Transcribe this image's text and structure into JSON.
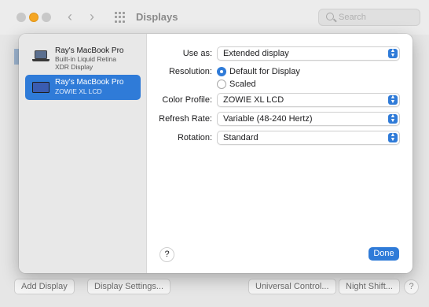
{
  "window": {
    "title": "Displays",
    "search_placeholder": "Search"
  },
  "sidebar": {
    "displays": [
      {
        "name": "Ray's MacBook Pro",
        "sub1": "Built-in Liquid Retina",
        "sub2": "XDR Display",
        "icon": "laptop-icon",
        "selected": false
      },
      {
        "name": "Ray's MacBook Pro",
        "sub1": "ZOWIE XL LCD",
        "icon": "monitor-icon",
        "selected": true
      }
    ]
  },
  "settings": {
    "use_as": {
      "label": "Use as:",
      "value": "Extended display"
    },
    "resolution": {
      "label": "Resolution:",
      "options": [
        {
          "label": "Default for Display",
          "selected": true
        },
        {
          "label": "Scaled",
          "selected": false
        }
      ]
    },
    "color_profile": {
      "label": "Color Profile:",
      "value": "ZOWIE XL LCD"
    },
    "refresh_rate": {
      "label": "Refresh Rate:",
      "value": "Variable (48-240 Hertz)"
    },
    "rotation": {
      "label": "Rotation:",
      "value": "Standard"
    }
  },
  "sheet_footer": {
    "help_label": "?",
    "done_label": "Done"
  },
  "bottom_bar": {
    "add_display": "Add Display",
    "display_settings": "Display Settings...",
    "universal_control": "Universal Control...",
    "night_shift": "Night Shift...",
    "help": "?"
  },
  "colors": {
    "accent": "#2f7bd8",
    "traffic_minimize": "#f5a623"
  }
}
